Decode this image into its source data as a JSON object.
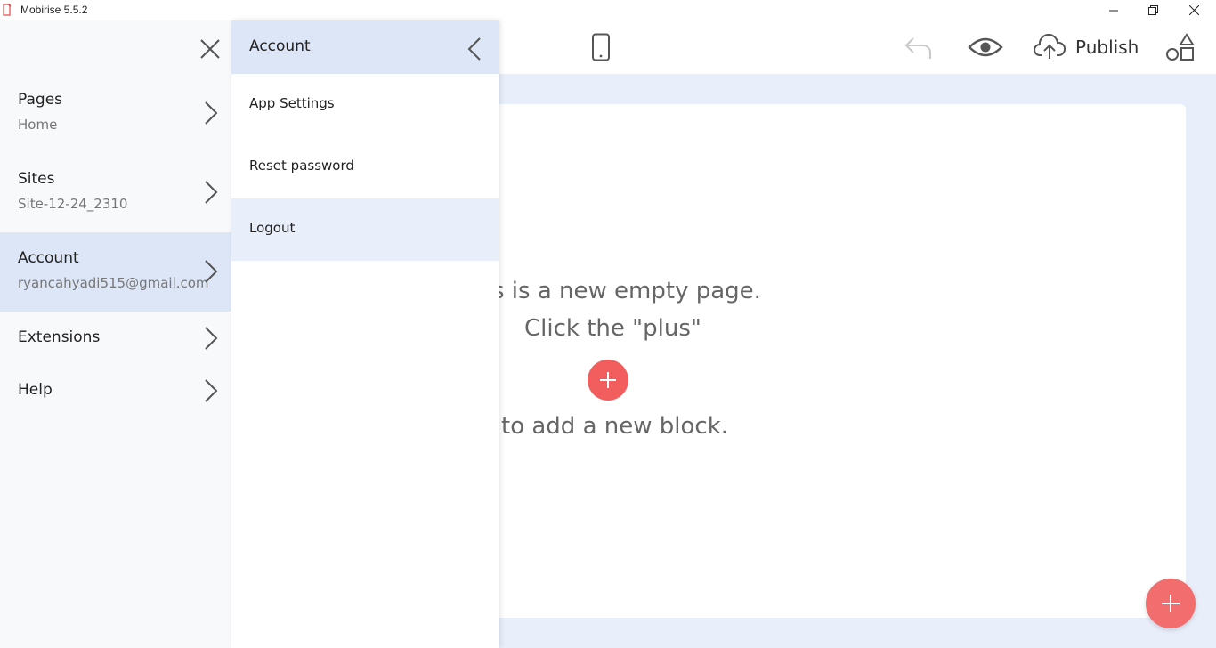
{
  "window": {
    "title": "Mobirise 5.5.2"
  },
  "toolbar": {
    "publish_label": "Publish"
  },
  "canvas": {
    "line1": "s is a new empty page.",
    "line2": "Click the \"plus\"",
    "line3": "to add a new block."
  },
  "sidebar": {
    "items": [
      {
        "title": "Pages",
        "sub": "Home"
      },
      {
        "title": "Sites",
        "sub": "Site-12-24_2310"
      },
      {
        "title": "Account",
        "sub": "ryancahyadi515@gmail.com"
      },
      {
        "title": "Extensions"
      },
      {
        "title": "Help"
      }
    ]
  },
  "submenu": {
    "title": "Account",
    "items": [
      {
        "label": "App Settings"
      },
      {
        "label": "Reset password"
      },
      {
        "label": "Logout"
      }
    ]
  },
  "colors": {
    "accent": "#f25e5e",
    "active_bg": "#dde6f7",
    "canvas_bg": "#e8eefa"
  }
}
